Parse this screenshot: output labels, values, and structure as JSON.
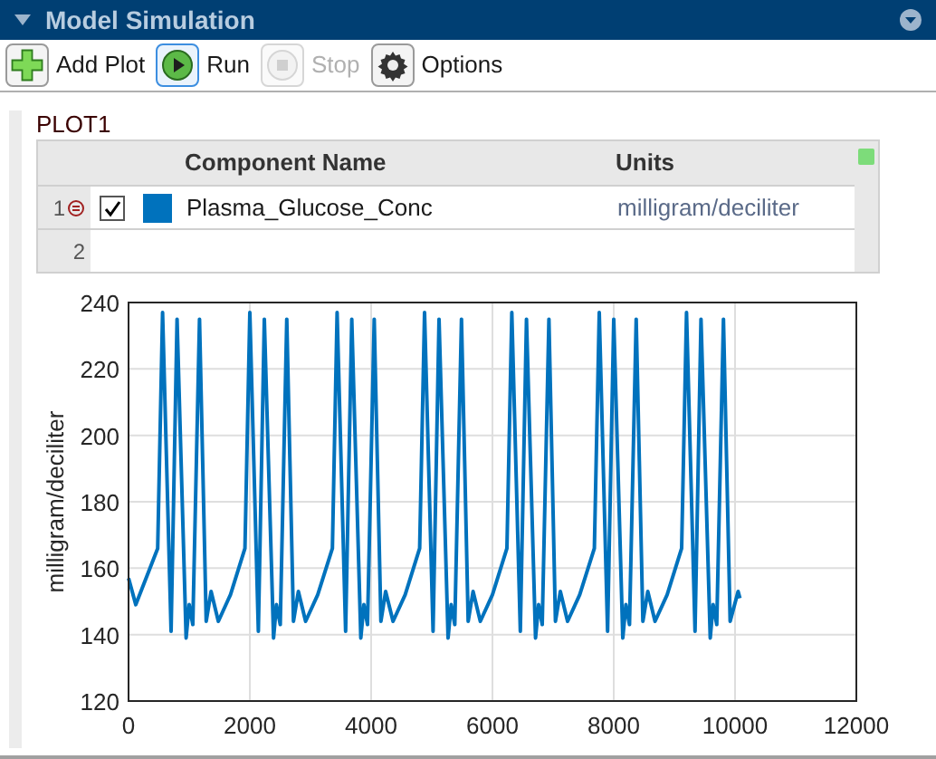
{
  "window": {
    "title": "Model Simulation"
  },
  "toolbar": [
    {
      "label": "Add Plot",
      "kind": "add",
      "disabled": false
    },
    {
      "label": "Run",
      "kind": "run",
      "disabled": false
    },
    {
      "label": "Stop",
      "kind": "stop",
      "disabled": true
    },
    {
      "label": "Options",
      "kind": "options",
      "disabled": false
    }
  ],
  "plot": {
    "title": "PLOT1",
    "table": {
      "columns": [
        "Component Name",
        "Units"
      ],
      "rows": [
        {
          "number": "1",
          "checked": true,
          "color": "#0072bd",
          "name": "Plasma_Glucose_Conc",
          "units": "milligram/deciliter"
        },
        {
          "number": "2"
        }
      ]
    },
    "chart_data": {
      "type": "line",
      "grid": true,
      "ylabel": "milligram/deciliter",
      "xlim": [
        0,
        12000
      ],
      "ylim": [
        120,
        240
      ],
      "xticks": [
        0,
        2000,
        4000,
        6000,
        8000,
        10000,
        12000
      ],
      "yticks": [
        120,
        140,
        160,
        180,
        200,
        220,
        240
      ],
      "x": [
        0,
        120,
        480,
        560,
        700,
        800,
        950,
        1000,
        1060,
        1170,
        1280,
        1360,
        1480,
        1680,
        1920,
        2000,
        2140,
        2240,
        2390,
        2440,
        2500,
        2610,
        2720,
        2800,
        2920,
        3120,
        3360,
        3440,
        3580,
        3680,
        3830,
        3880,
        3940,
        4050,
        4160,
        4240,
        4360,
        4560,
        4800,
        4880,
        5020,
        5120,
        5270,
        5320,
        5380,
        5490,
        5600,
        5680,
        5800,
        6000,
        6240,
        6320,
        6460,
        6560,
        6710,
        6760,
        6820,
        6930,
        7040,
        7120,
        7240,
        7440,
        7680,
        7760,
        7900,
        8000,
        8150,
        8200,
        8260,
        8370,
        8480,
        8560,
        8680,
        8880,
        9120,
        9200,
        9340,
        9440,
        9590,
        9640,
        9700,
        9810,
        9920,
        10050,
        10080
      ],
      "series": [
        {
          "color": "#0072bd",
          "values": [
            157,
            149,
            166,
            237,
            141,
            235,
            139,
            149,
            143,
            235,
            144,
            153,
            144,
            152,
            166,
            237,
            141,
            235,
            139,
            149,
            143,
            235,
            144,
            153,
            144,
            152,
            166,
            237,
            141,
            235,
            139,
            149,
            143,
            235,
            144,
            153,
            144,
            152,
            166,
            237,
            141,
            235,
            139,
            149,
            143,
            235,
            144,
            153,
            144,
            152,
            166,
            237,
            141,
            235,
            139,
            149,
            143,
            235,
            144,
            153,
            144,
            152,
            166,
            237,
            141,
            235,
            139,
            149,
            143,
            235,
            144,
            153,
            144,
            152,
            166,
            237,
            141,
            235,
            139,
            149,
            143,
            235,
            144,
            153,
            151
          ]
        }
      ]
    }
  }
}
